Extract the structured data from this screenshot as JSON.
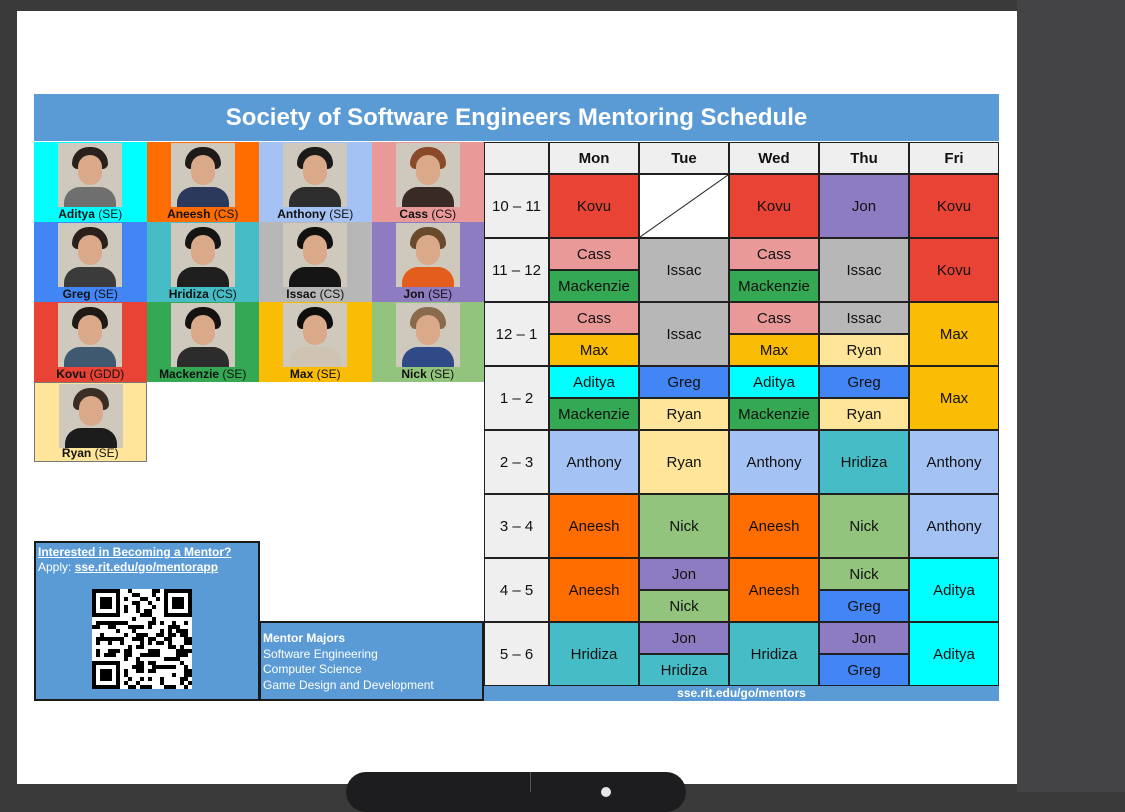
{
  "title": "Society of Software Engineers Mentoring Schedule",
  "colors": {
    "banner": "#5b9bd5",
    "red": "#e84335",
    "pink": "#ea9999",
    "green": "#35a853",
    "gray": "#b7b7b7",
    "purple": "#8e7cc3",
    "orange": "#ff6d01",
    "yellow": "#fbbc04",
    "paleyellow": "#ffe599",
    "cyan": "#00ffff",
    "blue": "#4285f4",
    "lightblue": "#a4c2f4",
    "teal": "#46bdc6",
    "lightgreen": "#93c47d",
    "header": "#efefef"
  },
  "mentors": [
    {
      "name": "Aditya",
      "major": "(SE)",
      "bg": "#00ffff",
      "hair": "#2a211c",
      "shirt": "#6f6f6f"
    },
    {
      "name": "Aneesh",
      "major": "(CS)",
      "bg": "#ff6d01",
      "hair": "#1e1a17",
      "shirt": "#2b3a5c"
    },
    {
      "name": "Anthony",
      "major": "(SE)",
      "bg": "#a4c2f4",
      "hair": "#1a1a1a",
      "shirt": "#2d2d2d"
    },
    {
      "name": "Cass",
      "major": "(CS)",
      "bg": "#ea9999",
      "hair": "#8a4a2a",
      "shirt": "#3a2a26"
    },
    {
      "name": "Greg",
      "major": "(SE)",
      "bg": "#4285f4",
      "hair": "#2b211a",
      "shirt": "#3b3b3b"
    },
    {
      "name": "Hridiza",
      "major": "(CS)",
      "bg": "#46bdc6",
      "hair": "#141414",
      "shirt": "#1f1f1f"
    },
    {
      "name": "Issac",
      "major": "(CS)",
      "bg": "#b7b7b7",
      "hair": "#111111",
      "shirt": "#151515"
    },
    {
      "name": "Jon",
      "major": "(SE)",
      "bg": "#8e7cc3",
      "hair": "#6b4a2b",
      "shirt": "#e35d1c"
    },
    {
      "name": "Kovu",
      "major": "(GDD)",
      "bg": "#e84335",
      "hair": "#1f1a16",
      "shirt": "#3f5a70"
    },
    {
      "name": "Mackenzie",
      "major": "(SE)",
      "bg": "#35a853",
      "hair": "#141110",
      "shirt": "#2c2c2c"
    },
    {
      "name": "Max",
      "major": "(SE)",
      "bg": "#fbbc04",
      "hair": "#0e0e0e",
      "shirt": "#cfc3b3"
    },
    {
      "name": "Nick",
      "major": "(SE)",
      "bg": "#93c47d",
      "hair": "#8a6a4a",
      "shirt": "#2f4a86"
    },
    {
      "name": "Ryan",
      "major": "(SE)",
      "bg": "#ffe599",
      "hair": "#3a2e24",
      "shirt": "#1c1c1c"
    }
  ],
  "days": [
    "Mon",
    "Tue",
    "Wed",
    "Thu",
    "Fri"
  ],
  "times": [
    "10 – 11",
    "11 – 12",
    "12 – 1",
    "1 – 2",
    "2 – 3",
    "3 – 4",
    "4 – 5",
    "5 – 6"
  ],
  "schedule": [
    [
      [
        {
          "name": "Kovu",
          "c": "red"
        }
      ],
      [
        {
          "name": "",
          "c": "empty"
        }
      ],
      [
        {
          "name": "Kovu",
          "c": "red"
        }
      ],
      [
        {
          "name": "Jon",
          "c": "purple"
        }
      ],
      [
        {
          "name": "Kovu",
          "c": "red"
        }
      ]
    ],
    [
      [
        {
          "name": "Cass",
          "c": "pink"
        },
        {
          "name": "Mackenzie",
          "c": "green"
        }
      ],
      [
        {
          "name": "Issac",
          "c": "gray"
        }
      ],
      [
        {
          "name": "Cass",
          "c": "pink"
        },
        {
          "name": "Mackenzie",
          "c": "green"
        }
      ],
      [
        {
          "name": "Issac",
          "c": "gray"
        }
      ],
      [
        {
          "name": "Kovu",
          "c": "red"
        }
      ]
    ],
    [
      [
        {
          "name": "Cass",
          "c": "pink"
        },
        {
          "name": "Max",
          "c": "yellow"
        }
      ],
      [
        {
          "name": "Issac",
          "c": "gray"
        }
      ],
      [
        {
          "name": "Cass",
          "c": "pink"
        },
        {
          "name": "Max",
          "c": "yellow"
        }
      ],
      [
        {
          "name": "Issac",
          "c": "gray"
        },
        {
          "name": "Ryan",
          "c": "paleyellow"
        }
      ],
      [
        {
          "name": "Max",
          "c": "yellow"
        }
      ]
    ],
    [
      [
        {
          "name": "Aditya",
          "c": "cyan"
        },
        {
          "name": "Mackenzie",
          "c": "green"
        }
      ],
      [
        {
          "name": "Greg",
          "c": "blue"
        },
        {
          "name": "Ryan",
          "c": "paleyellow"
        }
      ],
      [
        {
          "name": "Aditya",
          "c": "cyan"
        },
        {
          "name": "Mackenzie",
          "c": "green"
        }
      ],
      [
        {
          "name": "Greg",
          "c": "blue"
        },
        {
          "name": "Ryan",
          "c": "paleyellow"
        }
      ],
      [
        {
          "name": "Max",
          "c": "yellow"
        }
      ]
    ],
    [
      [
        {
          "name": "Anthony",
          "c": "lightblue"
        }
      ],
      [
        {
          "name": "Ryan",
          "c": "paleyellow"
        }
      ],
      [
        {
          "name": "Anthony",
          "c": "lightblue"
        }
      ],
      [
        {
          "name": "Hridiza",
          "c": "teal"
        }
      ],
      [
        {
          "name": "Anthony",
          "c": "lightblue"
        }
      ]
    ],
    [
      [
        {
          "name": "Aneesh",
          "c": "orange"
        }
      ],
      [
        {
          "name": "Nick",
          "c": "lightgreen"
        }
      ],
      [
        {
          "name": "Aneesh",
          "c": "orange"
        }
      ],
      [
        {
          "name": "Nick",
          "c": "lightgreen"
        }
      ],
      [
        {
          "name": "Anthony",
          "c": "lightblue"
        }
      ]
    ],
    [
      [
        {
          "name": "Aneesh",
          "c": "orange"
        }
      ],
      [
        {
          "name": "Jon",
          "c": "purple"
        },
        {
          "name": "Nick",
          "c": "lightgreen"
        }
      ],
      [
        {
          "name": "Aneesh",
          "c": "orange"
        }
      ],
      [
        {
          "name": "Nick",
          "c": "lightgreen"
        },
        {
          "name": "Greg",
          "c": "blue"
        }
      ],
      [
        {
          "name": "Aditya",
          "c": "cyan"
        }
      ]
    ],
    [
      [
        {
          "name": "Hridiza",
          "c": "teal"
        }
      ],
      [
        {
          "name": "Jon",
          "c": "purple"
        },
        {
          "name": "Hridiza",
          "c": "teal"
        }
      ],
      [
        {
          "name": "Hridiza",
          "c": "teal"
        }
      ],
      [
        {
          "name": "Jon",
          "c": "purple"
        },
        {
          "name": "Greg",
          "c": "blue"
        }
      ],
      [
        {
          "name": "Aditya",
          "c": "cyan"
        }
      ]
    ]
  ],
  "footer_link": "sse.rit.edu/go/mentors",
  "apply": {
    "heading": "Interested in Becoming a Mentor?",
    "prefix": "Apply: ",
    "link": "sse.rit.edu/go/mentorapp"
  },
  "majors": {
    "title": "Mentor Majors",
    "items": [
      "Software Engineering",
      "Computer Science",
      "Game Design and Development"
    ]
  }
}
